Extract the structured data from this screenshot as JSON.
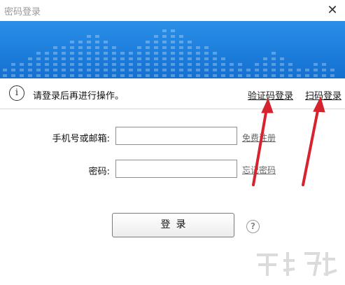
{
  "window": {
    "title": "密码登录",
    "close_glyph": "✕"
  },
  "info": {
    "icon_glyph": "i",
    "message": "请登录后再进行操作。",
    "sms_login_link": "验证码登录",
    "scan_login_link": "扫码登录"
  },
  "form": {
    "account_label": "手机号或邮箱:",
    "account_value": "",
    "register_link": "免费注册",
    "password_label": "密码:",
    "password_value": "",
    "forgot_link": "忘记密码",
    "login_button": "登录",
    "help_glyph": "?"
  },
  "colors": {
    "banner": "#1a79d8",
    "annotation_arrow": "#d6232e"
  },
  "icons": {
    "info": "info-icon",
    "help": "help-icon",
    "close": "close-icon"
  }
}
